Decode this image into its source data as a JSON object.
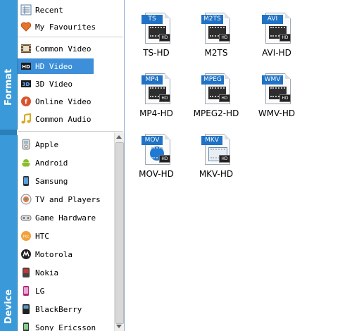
{
  "sidebar": {
    "tab_format": "Format",
    "tab_device": "Device",
    "recent": [
      {
        "label": "Recent",
        "icon": "recent-icon"
      },
      {
        "label": "My Favourites",
        "icon": "heart-icon"
      }
    ],
    "format_items": [
      {
        "label": "Common Video",
        "icon": "film-icon",
        "selected": false
      },
      {
        "label": "HD Video",
        "icon": "hd-icon",
        "selected": true
      },
      {
        "label": "3D Video",
        "icon": "3d-icon",
        "selected": false
      },
      {
        "label": "Online Video",
        "icon": "online-video-icon",
        "selected": false
      },
      {
        "label": "Common Audio",
        "icon": "music-note-icon",
        "selected": false
      }
    ],
    "device_items": [
      {
        "label": "Apple",
        "icon": "ipod-icon"
      },
      {
        "label": "Android",
        "icon": "android-icon"
      },
      {
        "label": "Samsung",
        "icon": "samsung-phone-icon"
      },
      {
        "label": "TV and Players",
        "icon": "tv-icon"
      },
      {
        "label": "Game Hardware",
        "icon": "gamepad-icon"
      },
      {
        "label": "HTC",
        "icon": "htc-icon"
      },
      {
        "label": "Motorola",
        "icon": "motorola-icon"
      },
      {
        "label": "Nokia",
        "icon": "nokia-icon"
      },
      {
        "label": "LG",
        "icon": "lg-phone-icon"
      },
      {
        "label": "BlackBerry",
        "icon": "blackberry-icon"
      },
      {
        "label": "Sony Ericsson",
        "icon": "sony-ericsson-icon"
      }
    ]
  },
  "formats": [
    {
      "tag": "TS",
      "name": "TS-HD"
    },
    {
      "tag": "M2TS",
      "name": "M2TS"
    },
    {
      "tag": "AVI",
      "name": "AVI-HD"
    },
    {
      "tag": "MP4",
      "name": "MP4-HD"
    },
    {
      "tag": "MPEG",
      "name": "MPEG2-HD"
    },
    {
      "tag": "WMV",
      "name": "WMV-HD"
    },
    {
      "tag": "MOV",
      "name": "MOV-HD"
    },
    {
      "tag": "MKV",
      "name": "MKV-HD"
    }
  ],
  "hd_badge": "HD",
  "colors": {
    "accent": "#3a9ad9",
    "selection": "#3c8fd8",
    "tag": "#1f72c4"
  }
}
